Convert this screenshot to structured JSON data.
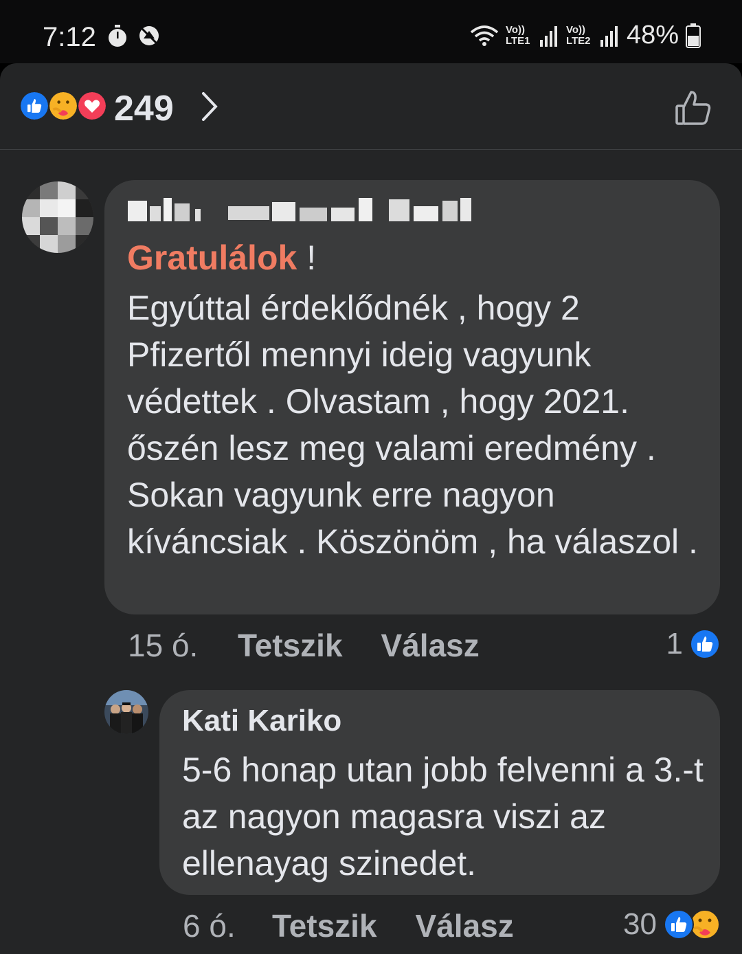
{
  "status_bar": {
    "time": "7:12",
    "sim1_label": "Vo)) LTE1",
    "sim2_label": "Vo)) LTE2",
    "battery": "48%"
  },
  "reactions": {
    "count": "249",
    "types": [
      "like-icon",
      "care-icon",
      "love-icon"
    ]
  },
  "comments": [
    {
      "mention": "Gratulálok",
      "mention_suffix": " !",
      "text": "Egyúttal érdeklődnék , hogy 2 Pfizertől mennyi ideig vagyunk védettek .  Olvastam , hogy 2021. őszén lesz meg valami eredmény . Sokan vagyunk erre nagyon kíváncsiak . Köszönöm , ha válaszol .",
      "time": "15 ó.",
      "like_label": "Tetszik",
      "reply_label": "Válasz",
      "reaction_count": "1"
    },
    {
      "author": "Kati Kariko",
      "text": "5-6 honap utan jobb felvenni a 3.-t az nagyon magasra viszi az ellenayag szinedet.",
      "time": "6 ó.",
      "like_label": "Tetszik",
      "reply_label": "Válasz",
      "reaction_count": "30"
    }
  ],
  "colors": {
    "background": "#242526",
    "bubble": "#3a3b3c",
    "mention": "#f07c62",
    "like_blue": "#1877f2",
    "love_red": "#f33e58"
  }
}
